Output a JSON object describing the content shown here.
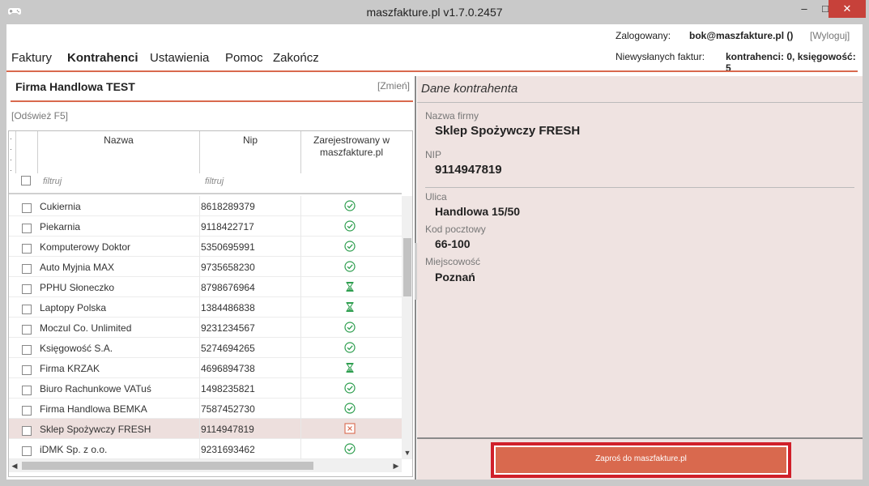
{
  "window": {
    "title": "maszfakture.pl  v1.7.0.2457",
    "minimize_glyph": "–",
    "maximize_glyph": "□",
    "close_glyph": "✕",
    "app_icon": "gamepad-icon"
  },
  "header": {
    "login_label": "Zalogowany:",
    "login_user": "bok@maszfakture.pl ()",
    "logout": "[Wyloguj]",
    "unsent_label": "Niewysłanych faktur:",
    "unsent_value": "kontrahenci: 0, księgowość: 5",
    "accent_color": "#d9694e"
  },
  "menu": {
    "items": [
      {
        "label": "Faktury",
        "active": false
      },
      {
        "label": "Kontrahenci",
        "active": true
      },
      {
        "label": "Ustawienia",
        "active": false
      },
      {
        "label": "Pomoc",
        "active": false
      },
      {
        "label": "Zakończ",
        "active": false
      }
    ]
  },
  "left": {
    "company": "Firma Handlowa TEST",
    "change": "[Zmień]",
    "refresh": "[Odśwież F5]",
    "columns": {
      "name": "Nazwa",
      "nip": "Nip",
      "registered": "Zarejestrowany w maszfakture.pl"
    },
    "filter_name_placeholder": "filtruj",
    "filter_nip_placeholder": "filtruj",
    "rows": [
      {
        "name": "Cukiernia",
        "nip": "8618289379",
        "status": "registered",
        "selected": false
      },
      {
        "name": "Piekarnia",
        "nip": "9118422717",
        "status": "registered",
        "selected": false
      },
      {
        "name": "Komputerowy Doktor",
        "nip": "5350695991",
        "status": "registered",
        "selected": false
      },
      {
        "name": "Auto Myjnia MAX",
        "nip": "9735658230",
        "status": "registered",
        "selected": false
      },
      {
        "name": "PPHU Słoneczko",
        "nip": "8798676964",
        "status": "pending",
        "selected": false
      },
      {
        "name": "Laptopy Polska",
        "nip": "1384486838",
        "status": "pending",
        "selected": false
      },
      {
        "name": "Moczul Co. Unlimited",
        "nip": "9231234567",
        "status": "registered",
        "selected": false
      },
      {
        "name": "Księgowość S.A.",
        "nip": "5274694265",
        "status": "registered",
        "selected": false
      },
      {
        "name": "Firma KRZAK",
        "nip": "4696894738",
        "status": "pending",
        "selected": false
      },
      {
        "name": "Biuro Rachunkowe VATuś",
        "nip": "1498235821",
        "status": "registered",
        "selected": false
      },
      {
        "name": "Firma Handlowa BEMKA",
        "nip": "7587452730",
        "status": "registered",
        "selected": false
      },
      {
        "name": "Sklep Spożywczy FRESH",
        "nip": "9114947819",
        "status": "not-registered",
        "selected": true
      },
      {
        "name": "iDMK Sp. z o.o.",
        "nip": "9231693462",
        "status": "registered",
        "selected": false
      }
    ],
    "status_colors": {
      "registered": "#2e9e4f",
      "pending": "#2e9e4f",
      "not-registered": "#d9694e"
    }
  },
  "right": {
    "title": "Dane kontrahenta",
    "company_label": "Nazwa firmy",
    "company_value": "Sklep Spożywczy FRESH",
    "nip_label": "NIP",
    "nip_value": "9114947819",
    "street_label": "Ulica",
    "street_value": "Handlowa 15/50",
    "postal_label": "Kod pocztowy",
    "postal_value": "66-100",
    "city_label": "Miejscowość",
    "city_value": "Poznań",
    "invite_button": "Zaproś do maszfakture.pl",
    "invite_highlight_color": "#d0202a"
  }
}
